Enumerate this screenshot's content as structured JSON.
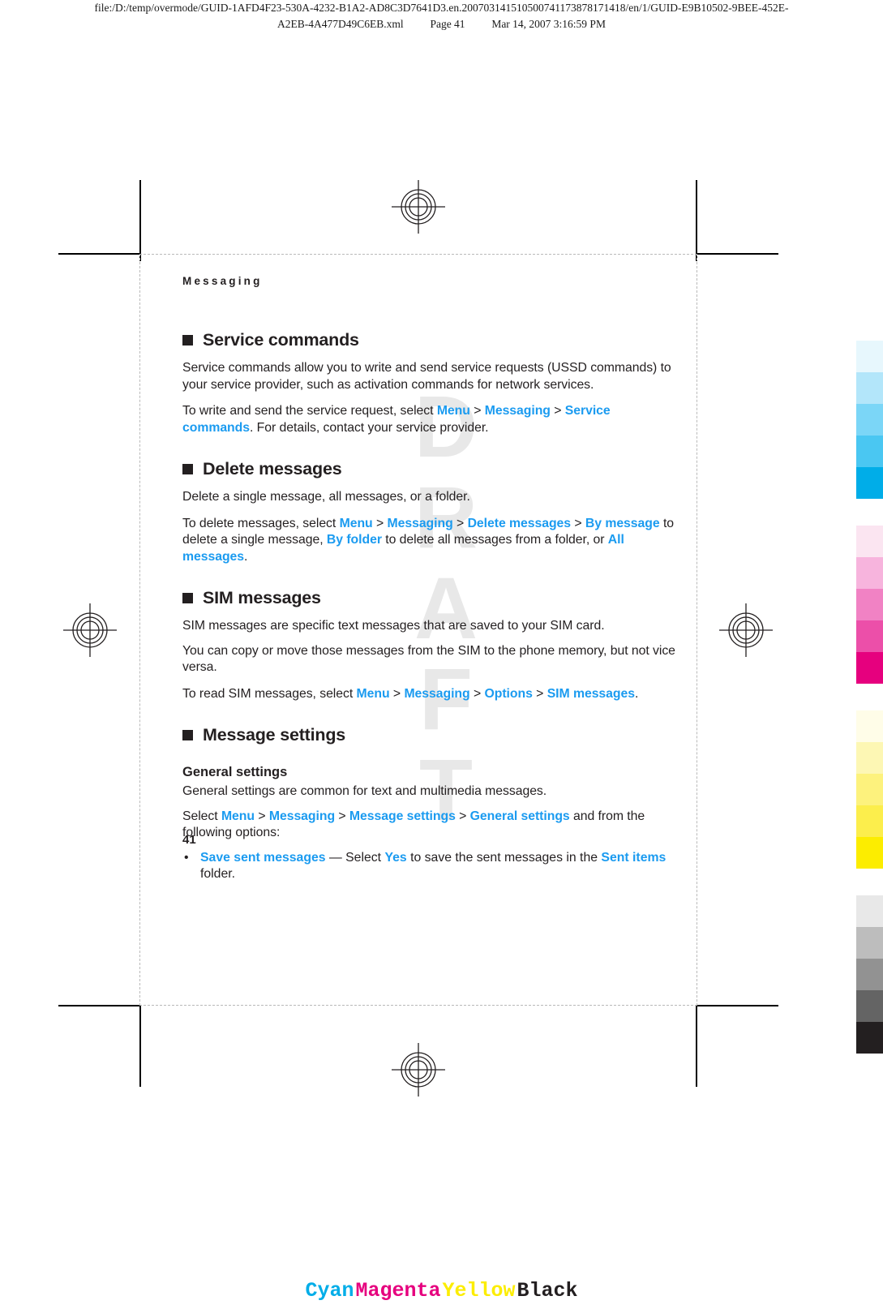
{
  "print_header": {
    "line1": "file:/D:/temp/overmode/GUID-1AFD4F23-530A-4232-B1A2-AD8C3D7641D3.en.20070314151050074117387817 1418/en/1/GUID-E9B10502-9BEE-452E-",
    "line1_actual": "file:/D:/temp/overmode/GUID-1AFD4F23-530A-4232-B1A2-AD8C3D7641D3.en.200703141510500741173878171418/en/1/GUID-E9B10502-9BEE-452E-",
    "line2_file": "A2EB-4A477D49C6EB.xml",
    "line2_page": "Page 41",
    "line2_date": "Mar 14, 2007 3:16:59 PM"
  },
  "running_head": "Messaging",
  "watermark": "DRAFT",
  "folio": "41",
  "sections": {
    "service_commands": {
      "heading": "Service commands",
      "p1": "Service commands allow you to write and send service requests (USSD commands) to your service provider, such as activation commands for network services.",
      "p2": {
        "pre": "To write and send the service request, select ",
        "l1": "Menu",
        "sep1": " > ",
        "l2": "Messaging",
        "sep2": " > ",
        "l3": "Service commands",
        "post": ". For details, contact your service provider."
      }
    },
    "delete_messages": {
      "heading": "Delete messages",
      "p1": "Delete a single message, all messages, or a folder.",
      "p2": {
        "pre": "To delete messages, select ",
        "l1": "Menu",
        "sep1": " > ",
        "l2": "Messaging",
        "sep2": " > ",
        "l3": "Delete messages",
        "sep3": " > ",
        "l4": "By message",
        "mid1": " to delete a single message, ",
        "l5": "By folder",
        "mid2": " to delete all messages from a folder, or ",
        "l6": "All messages",
        "post": "."
      }
    },
    "sim_messages": {
      "heading": "SIM messages",
      "p1": "SIM messages are specific text messages that are saved to your SIM card.",
      "p2": "You can copy or move those messages from the SIM to the phone memory, but not vice versa.",
      "p3": {
        "pre": "To read SIM messages, select ",
        "l1": "Menu",
        "sep1": " > ",
        "l2": "Messaging",
        "sep2": " > ",
        "l3": "Options",
        "sep3": " > ",
        "l4": "SIM messages",
        "post": "."
      }
    },
    "message_settings": {
      "heading": "Message settings",
      "general": {
        "subheading": "General settings",
        "p1": "General settings are common for text and multimedia messages.",
        "p2": {
          "pre": "Select ",
          "l1": "Menu",
          "sep1": " > ",
          "l2": "Messaging",
          "sep2": " > ",
          "l3": "Message settings",
          "sep3": " > ",
          "l4": "General settings",
          "post": " and from the following options:"
        },
        "bullets": [
          {
            "marker": "•",
            "l1": "Save sent messages",
            "mid1": " — Select ",
            "l2": "Yes",
            "mid2": " to save the sent messages in the ",
            "l3": "Sent items",
            "post": " folder."
          }
        ]
      }
    }
  },
  "color_strip": {
    "cyan": [
      "#e7f7fd",
      "#b3e6fa",
      "#7bd6f7",
      "#4ac7f2",
      "#00ade8"
    ],
    "magenta": [
      "#fbe5f1",
      "#f7b4dd",
      "#f182c4",
      "#ec4fa9",
      "#e6007e"
    ],
    "yellow": [
      "#fffde8",
      "#fdf7b4",
      "#fdf27d",
      "#fcee4c",
      "#fced00"
    ],
    "black": [
      "#e8e8e8",
      "#bdbdbd",
      "#929292",
      "#646464",
      "#231f20"
    ]
  },
  "cmyk_label": {
    "cyan": "Cyan",
    "cyan_color": "#00ade8",
    "magenta": "Magenta",
    "magenta_color": "#e6007e",
    "yellow": "Yellow",
    "yellow_color": "#fced00",
    "black": "Black",
    "black_color": "#231f20"
  }
}
